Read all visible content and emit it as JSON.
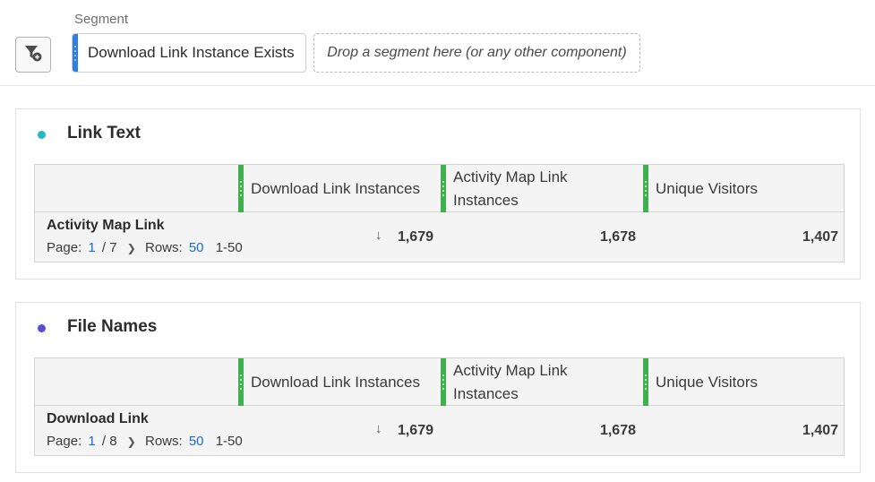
{
  "segment_bar": {
    "label": "Segment",
    "chip_text": "Download Link Instance Exists",
    "drop_placeholder": "Drop a segment here (or any other component)",
    "chip_color": "#2f7fe0"
  },
  "panels": [
    {
      "title": "Link Text",
      "dot_color": "#24b8c2",
      "columns": [
        "Download Link Instances",
        "Activity Map Link Instances",
        "Unique Visitors"
      ],
      "row": {
        "name": "Activity Map Link",
        "page_label": "Page:",
        "page_current": "1",
        "page_total": "/ 7",
        "rows_label": "Rows:",
        "rows_value": "50",
        "range": "1-50",
        "values": [
          "1,679",
          "1,678",
          "1,407"
        ]
      }
    },
    {
      "title": "File Names",
      "dot_color": "#5a4fcf",
      "columns": [
        "Download Link Instances",
        "Activity Map Link Instances",
        "Unique Visitors"
      ],
      "row": {
        "name": "Download Link",
        "page_label": "Page:",
        "page_current": "1",
        "page_total": "/ 8",
        "rows_label": "Rows:",
        "rows_value": "50",
        "range": "1-50",
        "values": [
          "1,679",
          "1,678",
          "1,407"
        ]
      }
    }
  ],
  "metric_bar_color": "#3fb04d"
}
